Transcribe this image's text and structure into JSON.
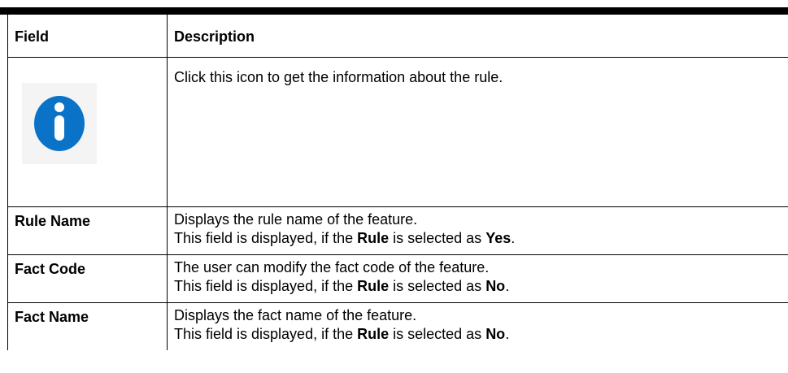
{
  "table": {
    "header": {
      "field": "Field",
      "description": "Description"
    },
    "icon_row": {
      "icon": "info-icon",
      "icon_color": "#0a72c7",
      "description": "Click this icon to get the information about the rule."
    },
    "rows": [
      {
        "field": "Rule Name",
        "line1": "Displays the rule name of the feature.",
        "line2_prefix": "This field is displayed, if the ",
        "line2_bold1": "Rule",
        "line2_mid": " is selected as ",
        "line2_bold2": "Yes",
        "line2_suffix": "."
      },
      {
        "field": "Fact Code",
        "line1": "The user can modify the fact code of the feature.",
        "line2_prefix": "This field is displayed, if the ",
        "line2_bold1": "Rule",
        "line2_mid": " is selected as ",
        "line2_bold2": "No",
        "line2_suffix": "."
      },
      {
        "field": "Fact Name",
        "line1": "Displays the fact name of the feature.",
        "line2_prefix": "This field is displayed, if the ",
        "line2_bold1": "Rule",
        "line2_mid": " is selected as ",
        "line2_bold2": "No",
        "line2_suffix": "."
      }
    ]
  }
}
